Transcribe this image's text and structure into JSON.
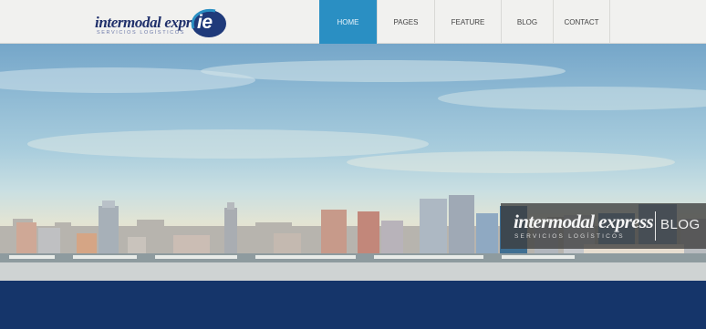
{
  "brand": {
    "name": "intermodal express",
    "tagline": "SERVICIOS LOGÍSTICOS",
    "badge_text": "ie"
  },
  "nav": {
    "items": [
      {
        "label": "HOME",
        "active": true
      },
      {
        "label": "PAGES",
        "active": false
      },
      {
        "label": "FEATURE",
        "active": false
      },
      {
        "label": "BLOG",
        "active": false
      },
      {
        "label": "CONTACT",
        "active": false
      }
    ]
  },
  "hero_badge": {
    "brand": "intermodal express",
    "tagline": "SERVICIOS LOGÍSTICOS",
    "section": "BLOG"
  },
  "colors": {
    "nav_active": "#2a8fc3",
    "band": "#15356a",
    "brand_navy": "#20306b"
  }
}
